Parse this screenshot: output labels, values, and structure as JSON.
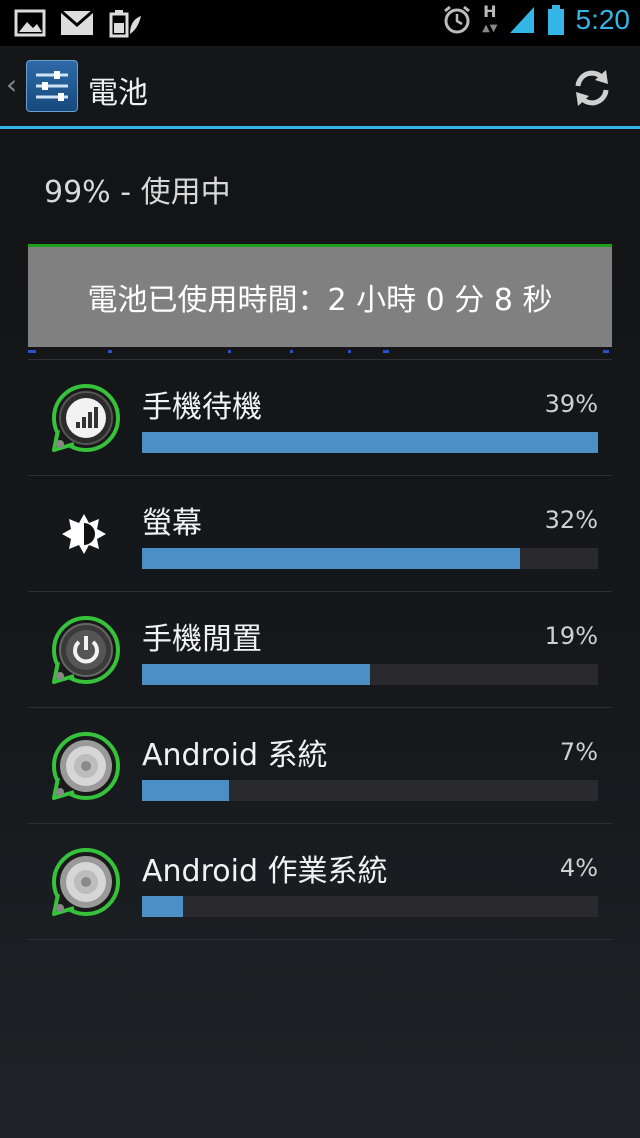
{
  "status_bar": {
    "time": "5:20",
    "network_label": "H",
    "icons": [
      "image-notification-icon",
      "mail-notification-icon",
      "battery-saver-notification-icon",
      "alarm-icon",
      "signal-icon",
      "battery-icon"
    ]
  },
  "action_bar": {
    "title": "電池",
    "icons": [
      "settings-sliders-icon",
      "refresh-icon"
    ]
  },
  "battery": {
    "level_text": "99% - 使用中",
    "usage_time_text": "電池已使用時間：2 小時 0 分 8 秒"
  },
  "usage_items": [
    {
      "label": "手機待機",
      "percent_text": "39%",
      "fraction": 1.0,
      "icon": "cell-standby-icon"
    },
    {
      "label": "螢幕",
      "percent_text": "32%",
      "fraction": 0.83,
      "icon": "brightness-icon"
    },
    {
      "label": "手機閒置",
      "percent_text": "19%",
      "fraction": 0.5,
      "icon": "power-icon"
    },
    {
      "label": "Android 系統",
      "percent_text": "7%",
      "fraction": 0.19,
      "icon": "android-system-icon"
    },
    {
      "label": "Android 作業系統",
      "percent_text": "4%",
      "fraction": 0.09,
      "icon": "android-os-icon"
    }
  ],
  "colors": {
    "accent": "#33b5e5",
    "bar": "#4a90c6",
    "graph_line": "#1e9c1e",
    "ring": "#36c23a"
  }
}
